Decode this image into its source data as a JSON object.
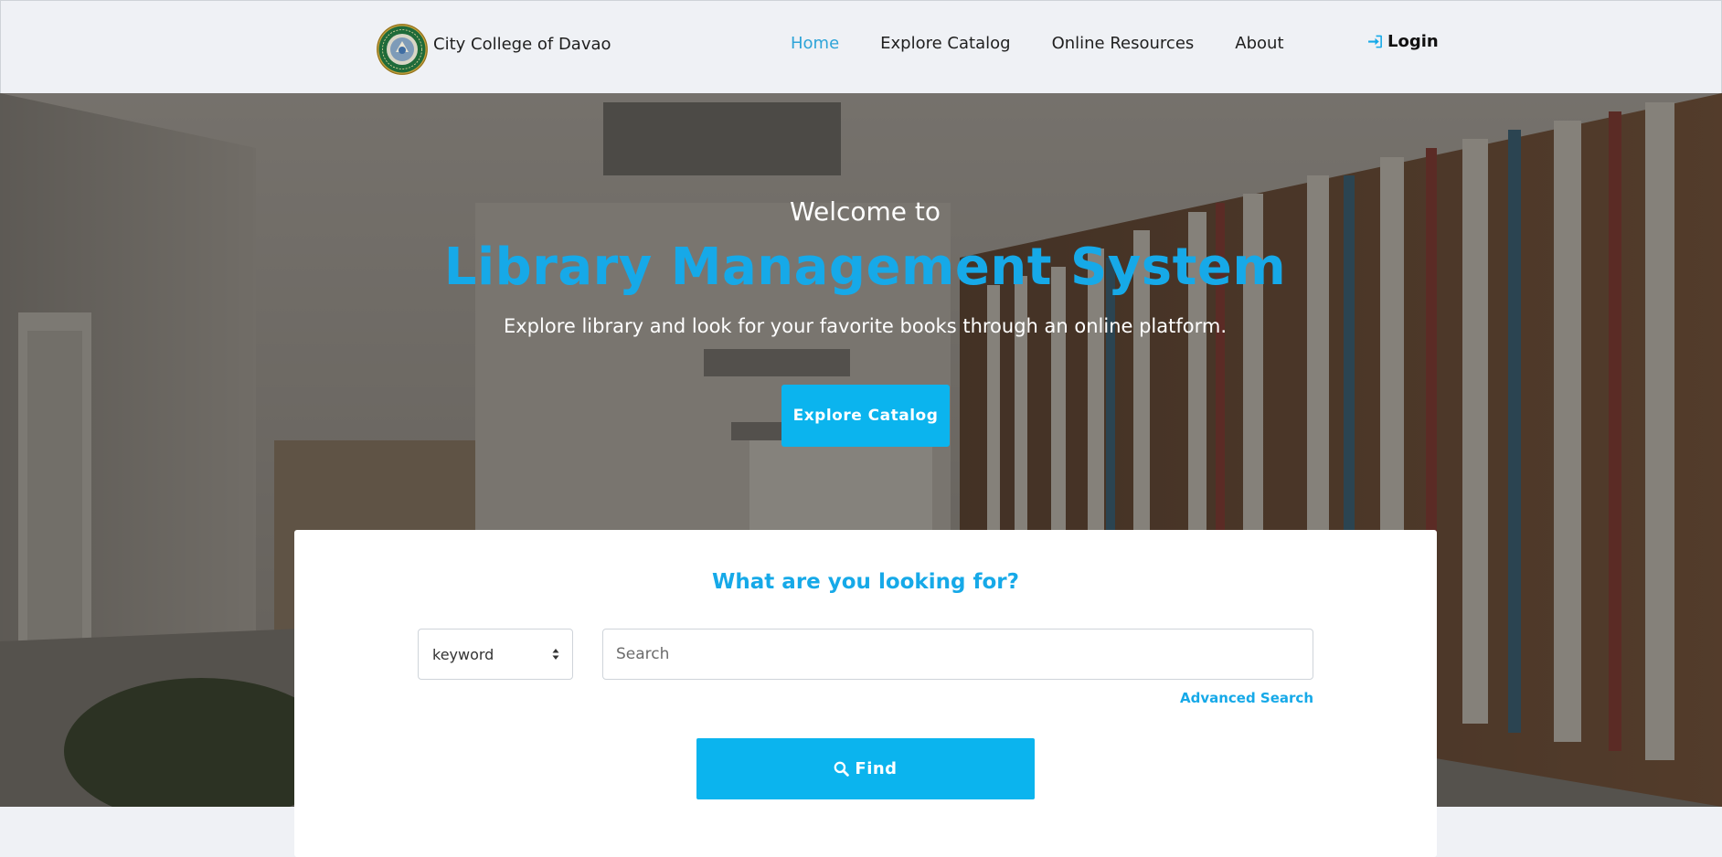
{
  "colors": {
    "accent": "#16a9e8",
    "button": "#0bb4ee",
    "navbar_bg": "#eff1f5",
    "card_bg": "#ffffff"
  },
  "navbar": {
    "brand_name": "City College of Davao",
    "links": [
      {
        "label": "Home",
        "active": true
      },
      {
        "label": "Explore Catalog",
        "active": false
      },
      {
        "label": "Online Resources",
        "active": false
      },
      {
        "label": "About",
        "active": false
      }
    ],
    "login_label": "Login",
    "login_icon": "sign-in-icon"
  },
  "hero": {
    "welcome": "Welcome to",
    "title": "Library Management System",
    "tagline": "Explore library and look for your favorite books through an online platform.",
    "cta_label": "Explore Catalog"
  },
  "search": {
    "heading": "What are you looking for?",
    "type_selected": "keyword",
    "placeholder": "Search",
    "value": "",
    "advanced_label": "Advanced Search",
    "advanced_icon": "plus-icon",
    "find_label": "Find",
    "find_icon": "search-icon"
  }
}
